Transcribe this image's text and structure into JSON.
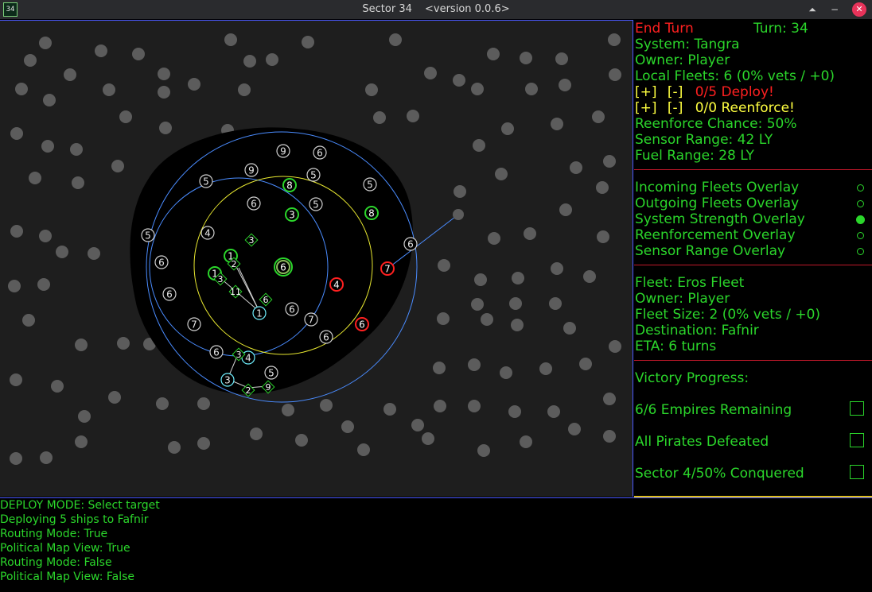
{
  "window": {
    "icon_text": "34",
    "title": "Sector 34",
    "version": "<version 0.0.6>",
    "controls": [
      "⏶",
      "−",
      "✕"
    ]
  },
  "panel": {
    "end_turn": "End Turn",
    "turn": "Turn: 34",
    "system": "System: Tangra",
    "owner": "Owner: Player",
    "local_fleets": "Local Fleets: 6 (0% vets / +0)",
    "deploy": {
      "plus": "[+]",
      "minus": "[-]",
      "text": "0/5 Deploy!"
    },
    "reenforce": {
      "plus": "[+]",
      "minus": "[-]",
      "text": "0/0 Reenforce!"
    },
    "reenforce_chance": "Reenforce Chance: 50%",
    "sensor_range": "Sensor Range: 42 LY",
    "fuel_range": "Fuel Range: 28 LY",
    "overlays": [
      {
        "label": "Incoming Fleets Overlay",
        "on": false
      },
      {
        "label": "Outgoing Fleets Overlay",
        "on": false
      },
      {
        "label": "System Strength Overlay",
        "on": true
      },
      {
        "label": "Reenforcement Overlay",
        "on": false
      },
      {
        "label": "Sensor Range Overlay",
        "on": false
      }
    ],
    "fleet": {
      "name": "Fleet: Eros Fleet",
      "owner": "Owner: Player",
      "size": "Fleet Size: 2 (0% vets / +0)",
      "destination": "Destination: Fafnir",
      "eta": "ETA: 6 turns"
    },
    "victory": {
      "title": "Victory Progress:",
      "items": [
        "6/6 Empires Remaining",
        "All Pirates Defeated",
        "Sector 4/50% Conquered"
      ]
    }
  },
  "log": [
    "DEPLOY MODE: Select target",
    "Deploying 5 ships to Fafnir",
    "Routing Mode: True",
    "Political Map View: True",
    "Routing Mode: False",
    "Political Map View: False"
  ],
  "colors": {
    "player": "#2bd62b",
    "enemy": "#ff2020",
    "neutral": "#d0d0d0",
    "fleet": "#6ff0ff",
    "sensor_ring": "#4a8cff",
    "fuel_ring": "#e8e830",
    "star": "#5c5c5c"
  },
  "map": {
    "systems": [
      {
        "label": "9",
        "owner": "neutral"
      },
      {
        "label": "6",
        "owner": "neutral"
      },
      {
        "label": "9",
        "owner": "neutral"
      },
      {
        "label": "5",
        "owner": "neutral"
      },
      {
        "label": "5",
        "owner": "neutral"
      },
      {
        "label": "8",
        "owner": "player"
      },
      {
        "label": "5",
        "owner": "neutral"
      },
      {
        "label": "6",
        "owner": "neutral"
      },
      {
        "label": "3",
        "owner": "player"
      },
      {
        "label": "5",
        "owner": "neutral"
      },
      {
        "label": "8",
        "owner": "player"
      },
      {
        "label": "5",
        "owner": "neutral"
      },
      {
        "label": "4",
        "owner": "neutral"
      },
      {
        "label": "6",
        "owner": "neutral"
      },
      {
        "label": "6",
        "owner": "neutral"
      },
      {
        "label": "7",
        "owner": "enemy"
      },
      {
        "label": "1",
        "owner": "player"
      },
      {
        "label": "6",
        "owner": "selected"
      },
      {
        "label": "1",
        "owner": "player"
      },
      {
        "label": "4",
        "owner": "enemy"
      },
      {
        "label": "6",
        "owner": "neutral"
      },
      {
        "label": "6",
        "owner": "neutral"
      },
      {
        "label": "7",
        "owner": "neutral"
      },
      {
        "label": "7",
        "owner": "neutral"
      },
      {
        "label": "6",
        "owner": "enemy"
      },
      {
        "label": "6",
        "owner": "neutral"
      },
      {
        "label": "6",
        "owner": "neutral"
      },
      {
        "label": "5",
        "owner": "neutral"
      },
      {
        "label": "1",
        "owner": "fleet"
      },
      {
        "label": "4",
        "owner": "fleet"
      },
      {
        "label": "3",
        "owner": "fleet"
      }
    ],
    "fleets": [
      "3",
      "2",
      "3",
      "11",
      "6",
      "3",
      "2",
      "9"
    ]
  }
}
